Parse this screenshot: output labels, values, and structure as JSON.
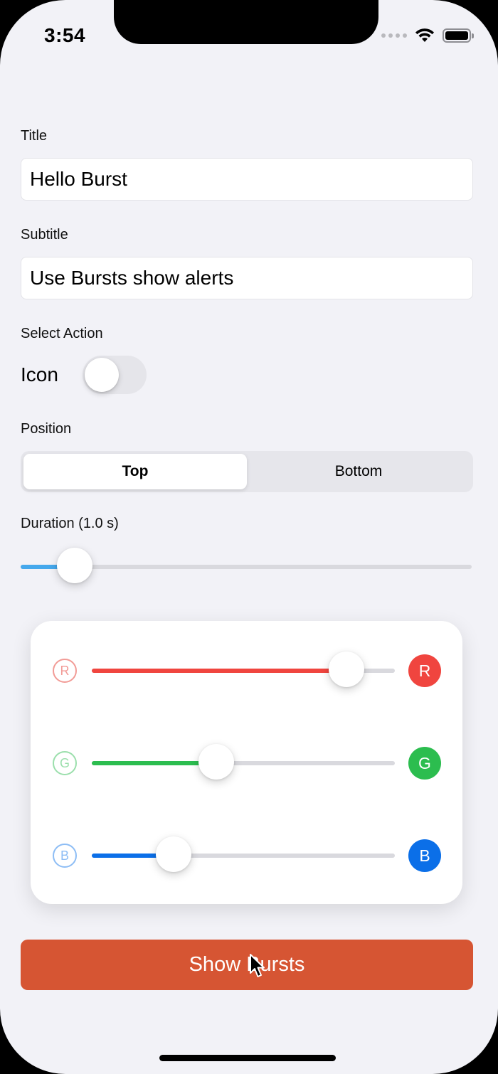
{
  "status_bar": {
    "time": "3:54"
  },
  "form": {
    "title_label": "Title",
    "title_value": "Hello Burst",
    "subtitle_label": "Subtitle",
    "subtitle_value": "Use Bursts show alerts",
    "action_label": "Select Action",
    "action_switch_label": "Icon",
    "action_switch_on": false,
    "position_label": "Position",
    "position_options": [
      "Top",
      "Bottom"
    ],
    "position_selected": "Top",
    "duration_label": "Duration (1.0 s)",
    "duration_value_fraction": 0.12
  },
  "color_picker": {
    "rows": [
      {
        "letter": "R",
        "fraction": 0.84,
        "color": "#f0453f",
        "outline_color": "#f29b96"
      },
      {
        "letter": "G",
        "fraction": 0.41,
        "color": "#2cbd4f",
        "outline_color": "#9bdfac"
      },
      {
        "letter": "B",
        "fraction": 0.27,
        "color": "#0b6fe8",
        "outline_color": "#8dbdf5"
      }
    ]
  },
  "show_button_label": "Show Bursts",
  "colors": {
    "accent_blue": "#45a8ec",
    "button_orange": "#d65533"
  }
}
